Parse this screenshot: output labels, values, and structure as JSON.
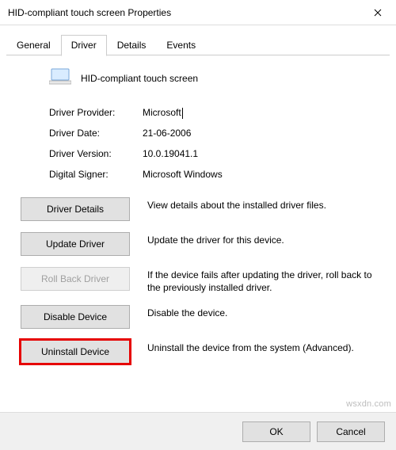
{
  "window": {
    "title": "HID-compliant touch screen Properties"
  },
  "tabs": [
    {
      "label": "General"
    },
    {
      "label": "Driver"
    },
    {
      "label": "Details"
    },
    {
      "label": "Events"
    }
  ],
  "device": {
    "name": "HID-compliant touch screen"
  },
  "info": {
    "provider_label": "Driver Provider:",
    "provider_value": "Microsoft",
    "date_label": "Driver Date:",
    "date_value": "21-06-2006",
    "version_label": "Driver Version:",
    "version_value": "10.0.19041.1",
    "signer_label": "Digital Signer:",
    "signer_value": "Microsoft Windows"
  },
  "actions": {
    "details": {
      "label": "Driver Details",
      "desc": "View details about the installed driver files."
    },
    "update": {
      "label": "Update Driver",
      "desc": "Update the driver for this device."
    },
    "rollback": {
      "label": "Roll Back Driver",
      "desc": "If the device fails after updating the driver, roll back to the previously installed driver."
    },
    "disable": {
      "label": "Disable Device",
      "desc": "Disable the device."
    },
    "uninstall": {
      "label": "Uninstall Device",
      "desc": "Uninstall the device from the system (Advanced)."
    }
  },
  "footer": {
    "ok": "OK",
    "cancel": "Cancel"
  },
  "watermark": "wsxdn.com"
}
